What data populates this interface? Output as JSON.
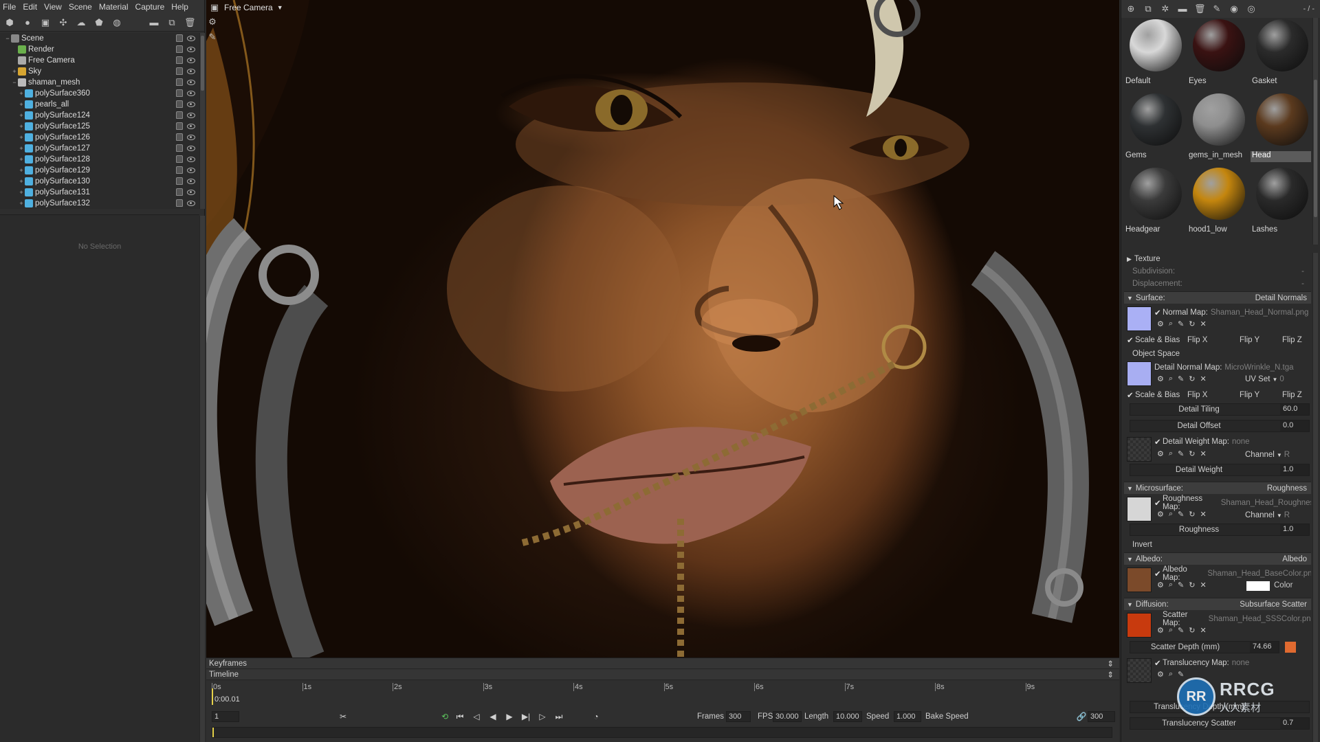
{
  "menu": [
    "File",
    "Edit",
    "View",
    "Scene",
    "Material",
    "Capture",
    "Help"
  ],
  "outliner": {
    "items": [
      {
        "label": "Scene",
        "depth": 0,
        "icon": "scene",
        "expanded": true
      },
      {
        "label": "Render",
        "depth": 1,
        "icon": "render"
      },
      {
        "label": "Free Camera",
        "depth": 1,
        "icon": "camera"
      },
      {
        "label": "Sky",
        "depth": 1,
        "icon": "sky",
        "collapsed": true
      },
      {
        "label": "shaman_mesh",
        "depth": 1,
        "icon": "mesh",
        "expanded": true
      },
      {
        "label": "polySurface360",
        "depth": 2,
        "icon": "poly"
      },
      {
        "label": "pearls_all",
        "depth": 2,
        "icon": "poly"
      },
      {
        "label": "polySurface124",
        "depth": 2,
        "icon": "poly"
      },
      {
        "label": "polySurface125",
        "depth": 2,
        "icon": "poly"
      },
      {
        "label": "polySurface126",
        "depth": 2,
        "icon": "poly"
      },
      {
        "label": "polySurface127",
        "depth": 2,
        "icon": "poly"
      },
      {
        "label": "polySurface128",
        "depth": 2,
        "icon": "poly"
      },
      {
        "label": "polySurface129",
        "depth": 2,
        "icon": "poly"
      },
      {
        "label": "polySurface130",
        "depth": 2,
        "icon": "poly"
      },
      {
        "label": "polySurface131",
        "depth": 2,
        "icon": "poly"
      },
      {
        "label": "polySurface132",
        "depth": 2,
        "icon": "poly"
      }
    ]
  },
  "properties": {
    "empty_label": "No Selection"
  },
  "viewport": {
    "camera_label": "Free Camera"
  },
  "timeline": {
    "keyframes_label": "Keyframes",
    "timeline_label": "Timeline",
    "ticks": [
      "0s",
      "1s",
      "2s",
      "3s",
      "4s",
      "5s",
      "6s",
      "7s",
      "8s",
      "9s"
    ],
    "current_time": "0:00.01",
    "current_frame": "1",
    "frames_label": "Frames",
    "frames": "300",
    "fps_label": "FPS",
    "fps": "30.000",
    "length_label": "Length",
    "length": "10.000",
    "speed_label": "Speed",
    "speed": "1.000",
    "bake_label": "Bake Speed",
    "end_frame": "300"
  },
  "material_toolbar": {
    "counter": "- / -"
  },
  "materials": [
    {
      "name": "Default",
      "color": "#d8d8d8",
      "selected": false
    },
    {
      "name": "Eyes",
      "color": "#3a1212",
      "selected": false
    },
    {
      "name": "Gasket",
      "color": "#2b2b2b",
      "selected": false
    },
    {
      "name": "Gems",
      "color": "#2e3133",
      "selected": false
    },
    {
      "name": "gems_in_mesh",
      "color": "#8e8e8e",
      "selected": false
    },
    {
      "name": "Head",
      "color": "#5b3a1e",
      "selected": true
    },
    {
      "name": "Headgear",
      "color": "#3b3b3b",
      "selected": false
    },
    {
      "name": "hood1_low",
      "color": "#c4860e",
      "selected": false
    },
    {
      "name": "Lashes",
      "color": "#2a2a2a",
      "selected": false
    }
  ],
  "mat_props": {
    "texture": "Texture",
    "subdivision": "Subdivision:",
    "subdivision_val": "-",
    "displacement": "Displacement:",
    "displacement_val": "-",
    "surface": "Surface:",
    "surface_val": "Detail Normals",
    "normal_map": "Normal Map:",
    "normal_map_file": "Shaman_Head_Normal.png",
    "scale_bias": "Scale & Bias",
    "flip_x": "Flip X",
    "flip_y": "Flip Y",
    "flip_z": "Flip Z",
    "object_space": "Object Space",
    "detail_normal_map": "Detail Normal Map:",
    "detail_normal_file": "MicroWrinkle_N.tga",
    "uv_set": "UV Set",
    "uv_set_val": "0",
    "detail_tiling": "Detail Tiling",
    "detail_tiling_val": "60.0",
    "detail_offset": "Detail Offset",
    "detail_offset_val": "0.0",
    "detail_weight_map": "Detail Weight Map:",
    "none": "none",
    "channel": "Channel",
    "channel_val": "R",
    "detail_weight": "Detail Weight",
    "detail_weight_val": "1.0",
    "microsurface": "Microsurface:",
    "microsurface_val": "Roughness",
    "roughness_map": "Roughness Map:",
    "roughness_file": "Shaman_Head_Roughness",
    "roughness": "Roughness",
    "roughness_val": "1.0",
    "invert": "Invert",
    "albedo": "Albedo:",
    "albedo_val": "Albedo",
    "albedo_map": "Albedo Map:",
    "albedo_file": "Shaman_Head_BaseColor.png",
    "color": "Color",
    "diffusion": "Diffusion:",
    "diffusion_val": "Subsurface Scatter",
    "scatter_map": "Scatter Map:",
    "scatter_file": "Shaman_Head_SSSColor.png",
    "scatter_depth": "Scatter Depth (mm)",
    "scatter_depth_val": "74.66",
    "translucency_map": "Translucency Map:",
    "translucency_depth": "Translucency Depth (mm)",
    "translucency_scatter": "Translucency Scatter",
    "translucency_scatter_val": "0.7",
    "colors": {
      "normal": "#aab0f5",
      "detail_normal": "#a8aef2",
      "albedo": "#7b4a2a",
      "scatter": "#c83a0e",
      "scatter_swatch": "#e06a30"
    }
  },
  "watermark": {
    "logo": "RR",
    "title": "RRCG",
    "subtitle": "人人素材"
  }
}
